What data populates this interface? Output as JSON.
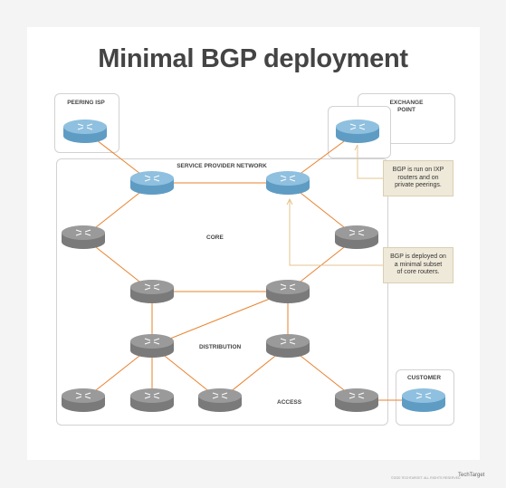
{
  "title": "Minimal BGP deployment",
  "regions": {
    "peering_isp": "PEERING ISP",
    "exchange_point": "EXCHANGE\nPOINT",
    "service_provider": "SERVICE PROVIDER NETWORK",
    "customer": "CUSTOMER"
  },
  "layers": {
    "core": "CORE",
    "distribution": "DISTRIBUTION",
    "access": "ACCESS"
  },
  "notes": {
    "ixp": "BGP is run on IXP\nrouters and on\nprivate peerings.",
    "core": "BGP is deployed on\na minimal subset\nof core routers."
  },
  "colors": {
    "bgp_router": "#7eb3d4",
    "plain_router": "#8a8a8a",
    "link": "#e8822e",
    "callout_bg": "#efe9d9"
  },
  "footer": {
    "copyright": "©2020 TECHTARGET. ALL RIGHTS RESERVED",
    "brand": "TechTarget"
  }
}
